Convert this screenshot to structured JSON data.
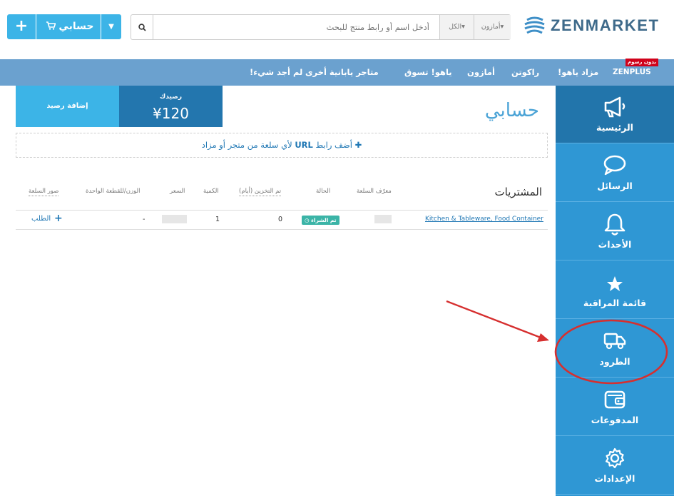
{
  "header": {
    "logo_text": "ZENMARKET",
    "add_button_label": "+",
    "account_button_label": "حسابي",
    "search": {
      "placeholder": "أدخل اسم أو رابط منتج للبحث",
      "category_filter": "الكل",
      "store_filter": "أمازون"
    }
  },
  "navbar": {
    "items": [
      {
        "label": "ZENPLUS",
        "badge": "بدون رسوم"
      },
      {
        "label": "مزاد ياهو!"
      },
      {
        "label": "راكوتن"
      },
      {
        "label": "أمازون"
      },
      {
        "label": "ياهو! تسوق"
      },
      {
        "label": "متاجر يابانية أخرى"
      },
      {
        "label": "لم أجد شيء!"
      }
    ]
  },
  "sidebar": {
    "items": [
      {
        "label": "الرئيسية",
        "icon": "megaphone-icon",
        "active": true
      },
      {
        "label": "الرسائل",
        "icon": "chat-bubble-icon"
      },
      {
        "label": "الأحداث",
        "icon": "bell-icon"
      },
      {
        "label": "قائمة المراقبة",
        "icon": "star-icon"
      },
      {
        "label": "الطرود",
        "icon": "truck-icon"
      },
      {
        "label": "المدفوعات",
        "icon": "wallet-icon"
      },
      {
        "label": "الإعدادات",
        "icon": "gear-icon"
      }
    ]
  },
  "main": {
    "page_title": "حسابي",
    "balance": {
      "label": "رصيدك",
      "value": "¥120"
    },
    "topup_label": "إضافة رصيد",
    "add_url": {
      "prefix": "أضف رابط",
      "url_word": "URL",
      "suffix": "لأي سلعة من متجر أو مزاد"
    },
    "purchases": {
      "title": "المشتريات",
      "columns": [
        "معرّف السلعة",
        "الحالة",
        "تم التخزين (أيام)",
        "الكمية",
        "السعر",
        "الوزن/للقطعة الواحدة",
        "صور السلعة"
      ],
      "rows": [
        {
          "item_name": "Kitchen & Tableware, Food Container",
          "status": "تم الشراء",
          "days_stored": "0",
          "quantity": "1",
          "weight": "-",
          "order_label": "الطلب"
        }
      ]
    }
  },
  "colors": {
    "primary": "#3cb4e7",
    "navbar": "#6ba1cf",
    "sidebar": "#2f97d4",
    "sidebar_active": "#2275ab",
    "balance_box": "#2376ae",
    "status_badge": "#3bb4a7",
    "annotation": "#d62f2f"
  }
}
